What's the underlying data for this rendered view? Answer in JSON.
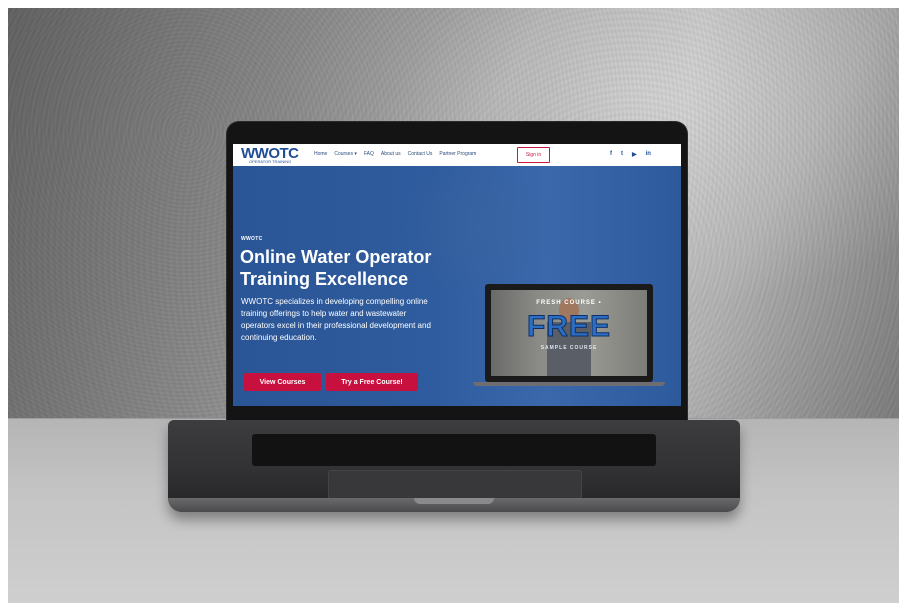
{
  "site": {
    "logo_text": "WWOTC",
    "logo_subtitle": "OPERATOR TRAINING",
    "nav": [
      "Home",
      "Courses ▾",
      "FAQ",
      "About us",
      "Contact Us",
      "Partner Program"
    ],
    "signin_label": "Sign in",
    "social_icons": [
      "facebook-icon",
      "twitter-icon",
      "youtube-icon",
      "linkedin-icon"
    ],
    "social_glyphs": [
      "f",
      "t",
      "▶",
      "in"
    ]
  },
  "hero": {
    "kicker": "WWOTC",
    "title": "Online Water Operator Training Excellence",
    "body": "WWOTC specializes in developing compelling online training offerings to help water and wastewater operators excel in their professional development and continuing education.",
    "primary_button": "View Courses",
    "secondary_button": "Try a Free Course!"
  },
  "promo": {
    "top_text": "FRESH COURSE • ",
    "big_text": "FREE",
    "bottom_text": "SAMPLE COURSE"
  },
  "colors": {
    "brand_blue": "#1f4e96",
    "accent_red": "#c8103e",
    "hero_blue": "#2f5c9e"
  }
}
